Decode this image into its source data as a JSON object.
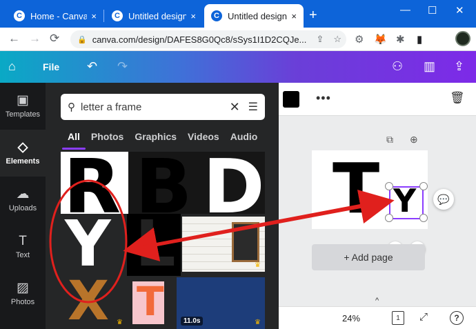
{
  "browser": {
    "tabs": [
      {
        "label": "Home - Canva",
        "active": false
      },
      {
        "label": "Untitled design - ...",
        "active": false
      },
      {
        "label": "Untitled design - ...",
        "active": true
      }
    ],
    "favicon_letter": "C",
    "close_glyph": "×",
    "new_tab_glyph": "+",
    "window_controls": [
      "—",
      "☐",
      "✕"
    ],
    "url": "canva.com/design/DAFES8G0Qc8/sSys1I1D2CQJe...",
    "lock_glyph": "🔒",
    "omnibox_actions": [
      "⇪",
      "☆"
    ],
    "nav": {
      "back": "←",
      "forward": "→",
      "reload": "⟳"
    },
    "extensions": [
      "⚙",
      "🦊",
      "✱",
      "▮"
    ]
  },
  "canva_header": {
    "home_icon": "⌂",
    "file_label": "File",
    "undo": "↶",
    "redo": "↷",
    "right_icons": [
      "⚇",
      "▥",
      "⇪"
    ]
  },
  "rail": [
    {
      "label": "Templates",
      "icon": "▣",
      "active": false
    },
    {
      "label": "Elements",
      "icon": "◇",
      "active": true
    },
    {
      "label": "Uploads",
      "icon": "☁",
      "active": false
    },
    {
      "label": "Text",
      "icon": "T",
      "active": false
    },
    {
      "label": "Photos",
      "icon": "▨",
      "active": false
    }
  ],
  "panel": {
    "search_icon": "⚲",
    "search_value": "letter a frame",
    "clear_glyph": "✕",
    "filter_glyph": "☰",
    "tabs": [
      "All",
      "Photos",
      "Graphics",
      "Videos",
      "Audio"
    ],
    "active_tab": "All",
    "tiles": {
      "r": "R",
      "b": "B",
      "d": "D",
      "y": "Y",
      "l": "L",
      "x": "X",
      "t": "T",
      "video_duration": "11.0s",
      "crown": "♛"
    },
    "collapse_glyph": "‹"
  },
  "editor": {
    "more_glyph": "•••",
    "trash_glyph": "🗑",
    "page_icons": [
      "⧉",
      "⊕"
    ],
    "canvas_letters": {
      "t": "T",
      "y": "Y"
    },
    "rotate_glyph": "↻",
    "move_glyph": "✥",
    "comment_glyph": "💬",
    "add_page_label": "+ Add page",
    "zoom": "24%",
    "pages_count": "1",
    "expand_glyph": "⤢",
    "help_glyph": "?",
    "caret_up": "^"
  },
  "colors": {
    "chrome_blue": "#0d64d9",
    "canva_purple": "#8b3dff",
    "annotation_red": "#e0201d"
  }
}
